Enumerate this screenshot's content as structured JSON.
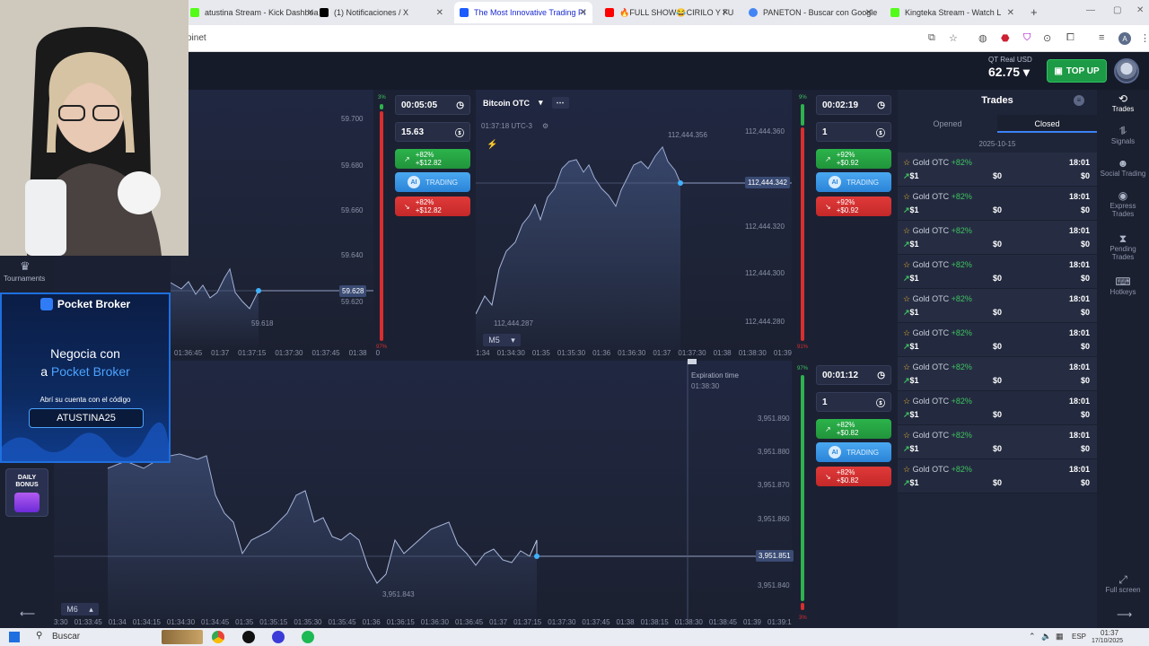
{
  "browser": {
    "tabs": [
      {
        "label": "atustina Stream - Kick Dashboa",
        "color": "#53fc18"
      },
      {
        "label": "(1) Notificaciones / X",
        "color": "#000000"
      },
      {
        "label": "The Most Innovative Trading Pl",
        "color": "#1b5cff"
      },
      {
        "label": "🔥FULL SHOW😂CIRILO Y FUS",
        "color": "#ff0000"
      },
      {
        "label": "PANETON - Buscar con Google",
        "color": "#4285f4"
      },
      {
        "label": "Kingteka Stream - Watch L",
        "color": "#53fc18"
      }
    ],
    "url": "oinet"
  },
  "header": {
    "balance_label": "QT Real   USD",
    "balance": "62.75 ▾",
    "topup": "TOP UP"
  },
  "chart1": {
    "prices": [
      "59.700",
      "59.680",
      "59.660",
      "59.640",
      "59.620"
    ],
    "current": "59.628",
    "low": "59.618",
    "times": [
      "01:36:45",
      "01:37",
      "01:37:15",
      "01:37:30",
      "01:37:45",
      "01:38",
      "0"
    ],
    "vol_top": "3%",
    "vol_bottom": "97%"
  },
  "panel1": {
    "timer": "00:05:05",
    "amount": "15.63",
    "up": "+82%\n+$12.82",
    "ai": "TRADING",
    "down": "+82%\n+$12.82"
  },
  "chart2": {
    "asset": "Bitcoin OTC",
    "time": "01:37:18 UTC-3",
    "prices": [
      "112,444.360",
      "112,444.340",
      "112,444.320",
      "112,444.300",
      "112,444.280"
    ],
    "current": "112,444.342",
    "high": "112,444.356",
    "low": "112,444.287",
    "timeframe": "M5",
    "times": [
      "1:34",
      "01:34:30",
      "01:35",
      "01:35:30",
      "01:36",
      "01:36:30",
      "01:37",
      "01:37:30",
      "01:38",
      "01:38:30",
      "01:39"
    ],
    "vol_top": "9%",
    "vol_bottom": "91%"
  },
  "panel2": {
    "timer": "00:02:19",
    "amount": "1",
    "up": "+92%\n+$0.92",
    "ai": "TRADING",
    "down": "+92%\n+$0.92"
  },
  "chart3": {
    "prices": [
      "3,951.890",
      "3,951.880",
      "3,951.870",
      "3,951.860",
      "3,951.840"
    ],
    "current": "3,951.851",
    "low": "3,951.843",
    "timeframe": "M6",
    "expiration_label": "Expiration time",
    "expiration_time": "01:38:30",
    "times": [
      "3:30",
      "01:33:45",
      "01:34",
      "01:34:15",
      "01:34:30",
      "01:34:45",
      "01:35",
      "01:35:15",
      "01:35:30",
      "01:35:45",
      "01:36",
      "01:36:15",
      "01:36:30",
      "01:36:45",
      "01:37",
      "01:37:15",
      "01:37:30",
      "01:37:45",
      "01:38",
      "01:38:15",
      "01:38:30",
      "01:38:45",
      "01:39",
      "01:39:1"
    ],
    "vol_top": "97%",
    "vol_bottom": "3%"
  },
  "panel3": {
    "timer": "00:01:12",
    "amount": "1",
    "up": "+82%\n+$0.82",
    "ai": "TRADING",
    "down": "+82%\n+$0.82"
  },
  "trades": {
    "title": "Trades",
    "tab_opened": "Opened",
    "tab_closed": "Closed",
    "date": "2025-10-15",
    "rows": [
      {
        "asset": "Gold OTC",
        "pct": "+82%",
        "amount": "$1",
        "payout": "$0",
        "time": "18:01",
        "result": "$0"
      },
      {
        "asset": "Gold OTC",
        "pct": "+82%",
        "amount": "$1",
        "payout": "$0",
        "time": "18:01",
        "result": "$0"
      },
      {
        "asset": "Gold OTC",
        "pct": "+82%",
        "amount": "$1",
        "payout": "$0",
        "time": "18:01",
        "result": "$0"
      },
      {
        "asset": "Gold OTC",
        "pct": "+82%",
        "amount": "$1",
        "payout": "$0",
        "time": "18:01",
        "result": "$0"
      },
      {
        "asset": "Gold OTC",
        "pct": "+82%",
        "amount": "$1",
        "payout": "$0",
        "time": "18:01",
        "result": "$0"
      },
      {
        "asset": "Gold OTC",
        "pct": "+82%",
        "amount": "$1",
        "payout": "$0",
        "time": "18:01",
        "result": "$0"
      },
      {
        "asset": "Gold OTC",
        "pct": "+82%",
        "amount": "$1",
        "payout": "$0",
        "time": "18:01",
        "result": "$0"
      },
      {
        "asset": "Gold OTC",
        "pct": "+82%",
        "amount": "$1",
        "payout": "$0",
        "time": "18:01",
        "result": "$0"
      },
      {
        "asset": "Gold OTC",
        "pct": "+82%",
        "amount": "$1",
        "payout": "$0",
        "time": "18:01",
        "result": "$0"
      },
      {
        "asset": "Gold OTC",
        "pct": "+82%",
        "amount": "$1",
        "payout": "$0",
        "time": "18:01",
        "result": "$0"
      }
    ]
  },
  "rightnav": [
    {
      "label": "Trades",
      "icon": "trades-icon"
    },
    {
      "label": "Signals",
      "icon": "signals-icon"
    },
    {
      "label": "Social Trading",
      "icon": "social-icon"
    },
    {
      "label": "Express Trades",
      "icon": "express-icon"
    },
    {
      "label": "Pending Trades",
      "icon": "pending-icon"
    },
    {
      "label": "Hotkeys",
      "icon": "hotkeys-icon"
    },
    {
      "label": "Full screen",
      "icon": "fullscreen-icon"
    }
  ],
  "leftnav": {
    "tournaments": "Tournaments",
    "daily_bonus": "DAILY BONUS"
  },
  "promo": {
    "brand": "Pocket Broker",
    "line1": "Negocia con",
    "line2a": "a ",
    "line2b": "Pocket Broker",
    "sub": "Abrí su cuenta con el código",
    "code": "ATUSTINA25"
  },
  "taskbar": {
    "search": "Buscar",
    "lang": "ESP",
    "time": "01:37",
    "date": "17/10/2025"
  }
}
